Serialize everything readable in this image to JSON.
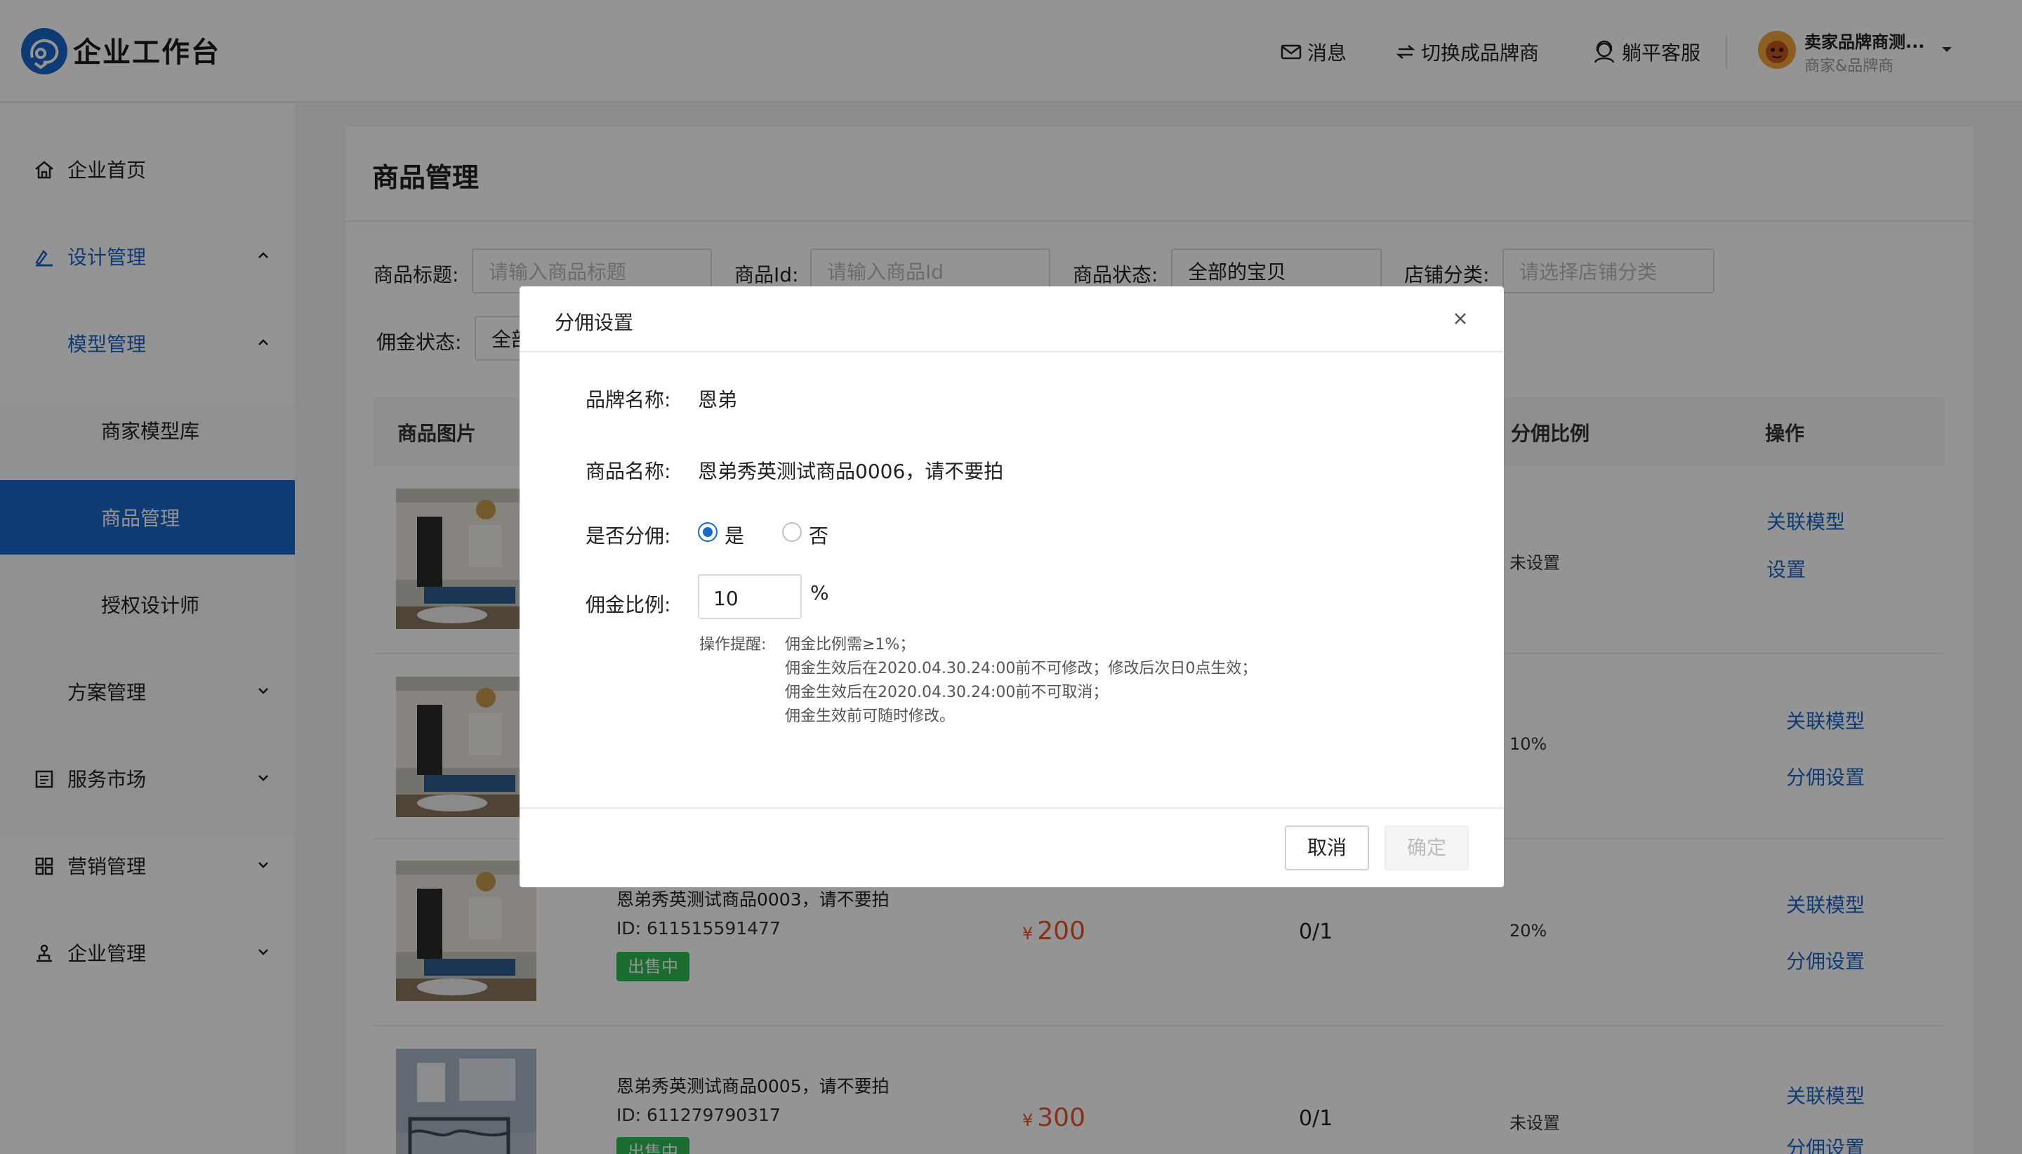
{
  "header": {
    "brand": "企业工作台",
    "messages": "消息",
    "switch_brand": "切换成品牌商",
    "service": "躺平客服",
    "user_name": "卖家品牌商测...",
    "user_role": "商家&品牌商"
  },
  "sidebar": {
    "items": [
      {
        "label": "企业首页",
        "icon": "home-icon"
      },
      {
        "label": "设计管理",
        "icon": "design-icon",
        "expanded": true
      },
      {
        "label": "模型管理",
        "expanded": true
      },
      {
        "label": "商家模型库"
      },
      {
        "label": "商品管理",
        "active": true
      },
      {
        "label": "授权设计师"
      },
      {
        "label": "方案管理"
      },
      {
        "label": "服务市场",
        "icon": "service-icon"
      },
      {
        "label": "营销管理",
        "icon": "marketing-icon"
      },
      {
        "label": "企业管理",
        "icon": "org-icon"
      }
    ]
  },
  "page": {
    "title": "商品管理",
    "filters": {
      "title_label": "商品标题:",
      "title_placeholder": "请输入商品标题",
      "id_label": "商品Id:",
      "id_placeholder": "请输入商品Id",
      "status_label": "商品状态:",
      "status_value": "全部的宝贝",
      "category_label": "店铺分类:",
      "category_placeholder": "请选择店铺分类",
      "commission_label": "佣金状态:",
      "commission_value": "全部"
    },
    "table": {
      "headers": {
        "image": "商品图片",
        "ratio": "分佣比例",
        "action": "操作"
      },
      "rows": [
        {
          "ratio": "未设置",
          "link1": "关联模型",
          "link2": "设置"
        },
        {
          "ratio": "10%",
          "link1": "关联模型",
          "link2": "分佣设置"
        },
        {
          "name": "恩弟秀英测试商品0003，请不要拍",
          "id": "ID: 611515591477",
          "status": "出售中",
          "currency": "¥",
          "price": "200",
          "count": "0/1",
          "ratio": "20%",
          "link1": "关联模型",
          "link2": "分佣设置"
        },
        {
          "name": "恩弟秀英测试商品0005，请不要拍",
          "id": "ID: 611279790317",
          "status": "出售中",
          "currency": "¥",
          "price": "300",
          "count": "0/1",
          "ratio": "未设置",
          "link1": "关联模型",
          "link2": "分佣设置"
        }
      ]
    }
  },
  "modal": {
    "title": "分佣设置",
    "brand_label": "品牌名称:",
    "brand_value": "恩弟",
    "product_label": "商品名称:",
    "product_value": "恩弟秀英测试商品0006，请不要拍",
    "split_label": "是否分佣:",
    "yes": "是",
    "no": "否",
    "rate_label": "佣金比例:",
    "rate_value": "10",
    "rate_unit": "%",
    "tip_title": "操作提醒:",
    "tips": [
      "佣金比例需≥1%；",
      "佣金生效后在2020.04.30.24:00前不可修改；修改后次日0点生效；",
      "佣金生效后在2020.04.30.24:00前不可取消；",
      "佣金生效前可随时修改。"
    ],
    "cancel": "取消",
    "confirm": "确定"
  }
}
